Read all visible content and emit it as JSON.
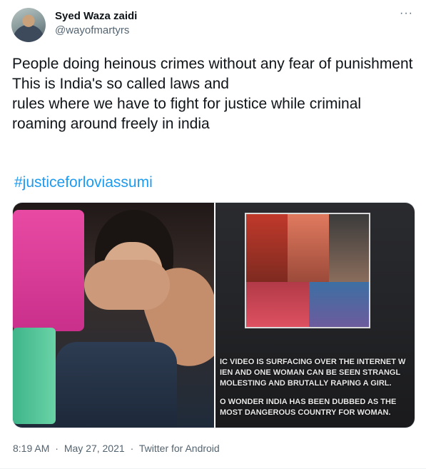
{
  "author": {
    "name": "Syed Waza zaidi",
    "handle": "@wayofmartyrs"
  },
  "menu": {
    "icon": "more-horizontal-icon",
    "glyph": "···"
  },
  "tweet": {
    "text": "People doing heinous crimes without any fear of punishment\nThis is India's so called laws and\nrules where we have to fight for justice while criminal roaming around freely in india",
    "hashtag": "#justiceforloviassumi"
  },
  "media": {
    "right_caption_1": "IC VIDEO IS SURFACING OVER THE INTERNET W\nIEN AND ONE WOMAN CAN BE SEEN STRANGL\nMOLESTING AND BRUTALLY RAPING A GIRL.",
    "right_caption_2": "O WONDER INDIA HAS BEEN DUBBED AS THE\nMOST DANGEROUS COUNTRY FOR WOMAN."
  },
  "meta": {
    "time": "8:19 AM",
    "separator": "·",
    "date": "May 27, 2021",
    "source": "Twitter for Android"
  },
  "colors": {
    "link": "#1d9bf0",
    "secondary_text": "#536471",
    "primary_text": "#0f1419"
  }
}
